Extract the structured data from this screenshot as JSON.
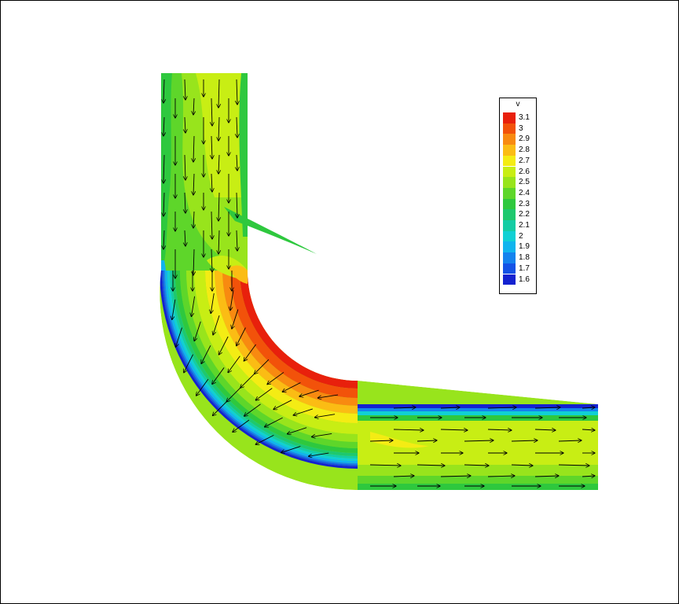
{
  "chart_data": {
    "type": "heatmap",
    "variable": "v",
    "legend_placement": "top-right",
    "legend": [
      {
        "label": "3.1",
        "color": "#e8200c"
      },
      {
        "label": "3",
        "color": "#f2520a"
      },
      {
        "label": "2.9",
        "color": "#f88a10"
      },
      {
        "label": "2.8",
        "color": "#fbbc14"
      },
      {
        "label": "2.7",
        "color": "#f4ec14"
      },
      {
        "label": "2.6",
        "color": "#c8ee14"
      },
      {
        "label": "2.5",
        "color": "#98e41c"
      },
      {
        "label": "2.4",
        "color": "#5ed62a"
      },
      {
        "label": "2.3",
        "color": "#2ec83e"
      },
      {
        "label": "2.2",
        "color": "#1ec86e"
      },
      {
        "label": "2.1",
        "color": "#14cca4"
      },
      {
        "label": "2",
        "color": "#10d0d4"
      },
      {
        "label": "1.9",
        "color": "#10b4ee"
      },
      {
        "label": "1.8",
        "color": "#1482ee"
      },
      {
        "label": "1.7",
        "color": "#1452e6"
      },
      {
        "label": "1.6",
        "color": "#1422d0"
      }
    ],
    "grid": false,
    "vectors": true
  }
}
